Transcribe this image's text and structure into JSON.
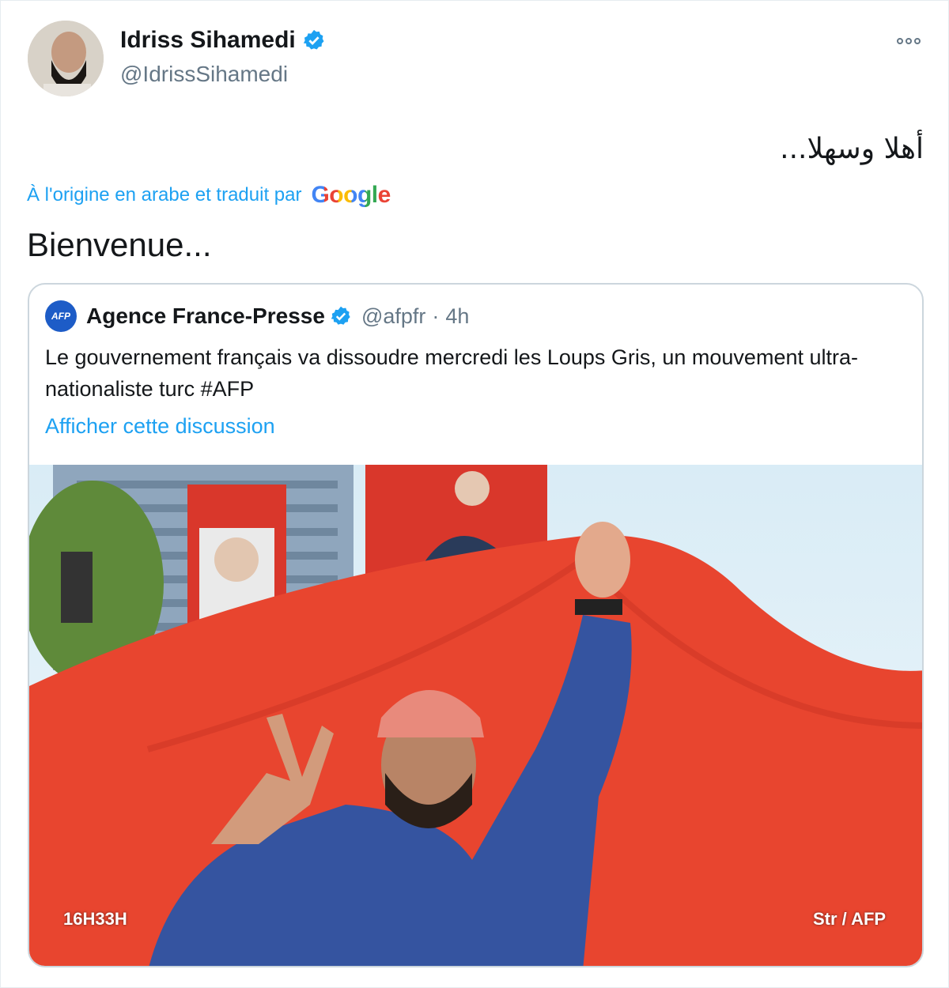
{
  "author": {
    "name": "Idriss Sihamedi",
    "handle": "@IdrissSihamedi",
    "avatar_icon": "profile-avatar",
    "verified_icon": "verified-badge-icon"
  },
  "menu": {
    "more_icon": "more-options-icon"
  },
  "tweet": {
    "original_text": "أهلا وسهلا...",
    "translated_from": "À l'origine en arabe et traduit par",
    "translator": "Google",
    "translation": "Bienvenue..."
  },
  "quoted": {
    "logo_text": "AFP",
    "name": "Agence France-Presse",
    "handle": "@afpfr",
    "separator": "·",
    "time": "4h",
    "text": "Le gouvernement français va dissoudre mercredi les Loups Gris, un mouvement ultra-nationaliste turc #AFP",
    "link": "Afficher cette discussion",
    "image_caption_left": "16H33H",
    "image_caption_right": "Str / AFP"
  },
  "colors": {
    "accent": "#1da1f2",
    "text": "#14171a",
    "muted": "#657786",
    "border": "#ccd6dd"
  }
}
